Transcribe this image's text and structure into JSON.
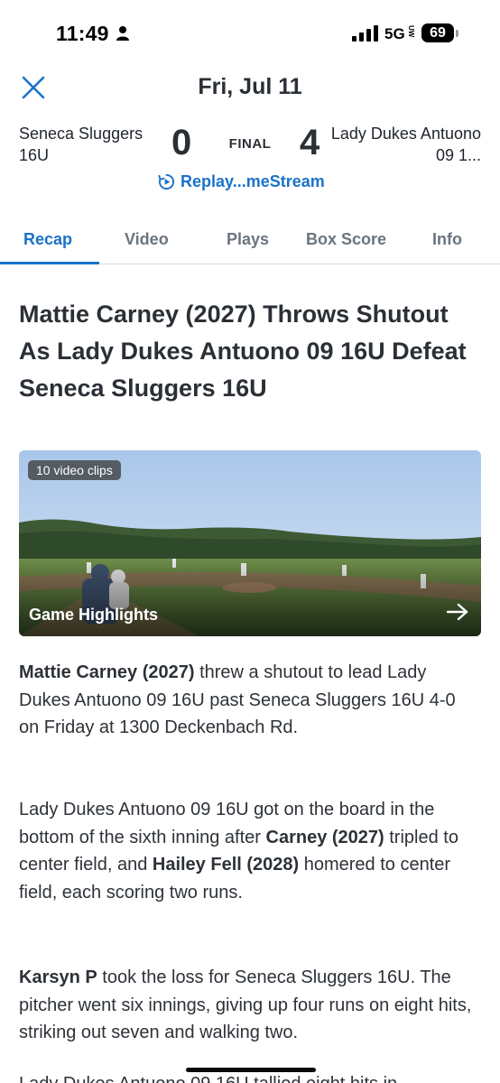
{
  "status_bar": {
    "time": "11:49",
    "network": "5G",
    "network_badge": "UW",
    "battery": "69",
    "icons": [
      "person-icon",
      "signal-icon",
      "battery-icon"
    ]
  },
  "header": {
    "date": "Fri, Jul 11",
    "close_icon": "close-icon"
  },
  "scoreboard": {
    "home_team": "Seneca Sluggers 16U",
    "home_score": "0",
    "status": "FINAL",
    "away_score": "4",
    "away_team": "Lady Dukes Antuono 09 1...",
    "replay_label": "Replay...meStream"
  },
  "tabs": [
    {
      "label": "Recap",
      "active": true
    },
    {
      "label": "Video",
      "active": false
    },
    {
      "label": "Plays",
      "active": false
    },
    {
      "label": "Box Score",
      "active": false
    },
    {
      "label": "Info",
      "active": false
    }
  ],
  "article": {
    "headline": "Mattie Carney (2027) Throws Shutout As Lady Dukes Antuono 09 16U Defeat Seneca Sluggers 16U",
    "video": {
      "badge": "10 video clips",
      "title": "Game Highlights"
    },
    "p1": {
      "bold": "Mattie Carney (2027)",
      "text": " threw a shutout to lead Lady Dukes Antuono 09 16U past Seneca Sluggers 16U 4-0 on Friday at 1300 Deckenbach Rd."
    },
    "p2": {
      "t1": "Lady Dukes Antuono 09 16U got on the board in the bottom of the sixth inning after ",
      "b1": "Carney (2027)",
      "t2": " tripled to center field, and ",
      "b2": "Hailey Fell (2028)",
      "t3": " homered to center field, each scoring two runs."
    },
    "p3": {
      "bold": "Karsyn P",
      "text": " took the loss for Seneca Sluggers 16U. The pitcher went six innings, giving up four runs on eight hits, striking out seven and walking two."
    },
    "p4": {
      "text": "Lady Dukes Antuono 09 16U tallied eight hits in"
    }
  },
  "colors": {
    "accent": "#1a73c9",
    "text": "#2d3238",
    "muted": "#6a747e"
  }
}
